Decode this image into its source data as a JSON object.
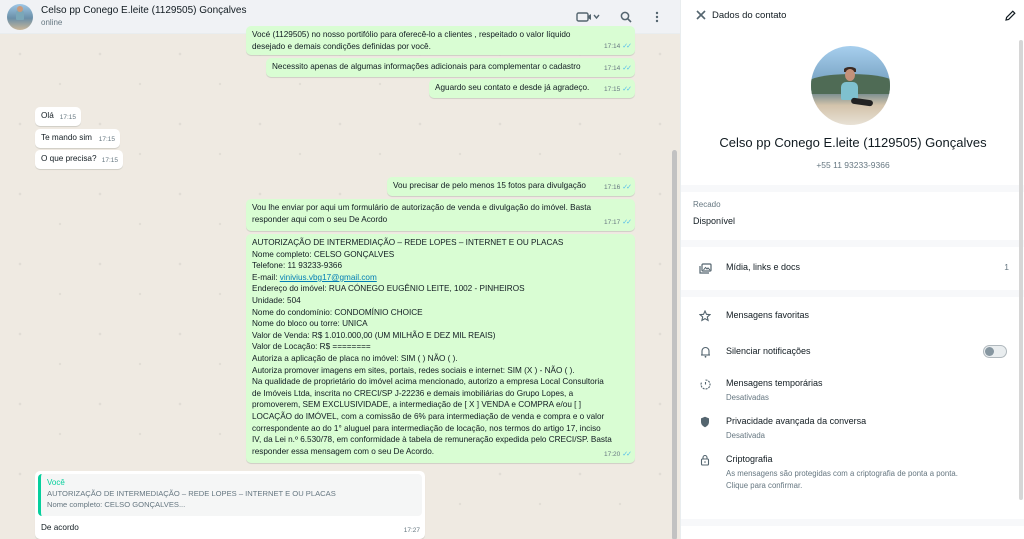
{
  "chat": {
    "title": "Celso pp Conego E.leite (1129505) Gonçalves",
    "status": "online",
    "icons": {
      "video": "video-call-icon",
      "search": "search-icon",
      "menu": "menu-icon"
    }
  },
  "messages": [
    {
      "dir": "out",
      "lines": [
        "Vocé (1129505) no nosso portifólio para oferecê-lo a clientes , respeitado o valor líquido",
        "desejado e demais condições definidas por você."
      ],
      "time": "17:14",
      "read": true
    },
    {
      "dir": "out",
      "lines": [
        "Necessito apenas de algumas informações adicionais para complementar o cadastro"
      ],
      "time": "17:14",
      "read": true
    },
    {
      "dir": "out",
      "lines": [
        "Aguardo seu contato e desde já agradeço."
      ],
      "time": "17:15",
      "read": true
    },
    {
      "dir": "in",
      "lines": [
        "Olá"
      ],
      "time": "17:15"
    },
    {
      "dir": "in",
      "lines": [
        "Te mando sim"
      ],
      "time": "17:15"
    },
    {
      "dir": "in",
      "lines": [
        "O que precisa?"
      ],
      "time": "17:15"
    },
    {
      "dir": "out",
      "lines": [
        "Vou precisar de pelo menos 15 fotos para divulgação"
      ],
      "time": "17:16",
      "read": true
    },
    {
      "dir": "out",
      "lines": [
        "Vou lhe enviar por aqui um formulário de autorização de venda e divulgação do imóvel. Basta",
        "responder aqui com o seu De Acordo"
      ],
      "time": "17:17",
      "read": true
    },
    {
      "dir": "out",
      "lines": [
        "AUTORIZAÇÃO DE INTERMEDIAÇÃO – REDE LOPES – INTERNET E OU PLACAS",
        "Nome completo: CELSO GONÇALVES",
        "Telefone: 11 93233-9366",
        "E-mail: vinivius.vbg17@gmail.com",
        "Endereço do imóvel: RUA CÓNEGO EUGÊNIO LEITE, 1002 - PINHEIROS",
        "Unidade: 504",
        "Nome do condomínio: CONDOMÍNIO CHOICE",
        "Nome do bloco ou torre: UNICA",
        "Valor de Venda: R$ 1.010.000,00 (UM MILHÃO E DEZ MIL REAIS)",
        "Valor de Locação: R$ ========",
        "Autoriza a aplicação de placa no imóvel: SIM (     )  NÃO (     ).",
        "Autoriza promover imagens em sites, portais, redes sociais e internet: SIM (X ) - NÃO (     ).",
        "Na qualidade de proprietário do imóvel acima mencionado, autorizo a empresa Local Consultoria",
        "de Imóveis Ltda, inscrita no CRECI/SP J-22236 e demais imobiliárias do Grupo Lopes, a",
        "promoverem, SEM EXCLUSIVIDADE, a intermediação de [   X   ] VENDA e COMPRA e/ou [    ]",
        "LOCAÇÃO do IMÓVEL, com a comissão de 6% para intermediação de venda e compra e o valor",
        "correspondente ao do 1° aluguel para intermediação de locação, nos termos do artigo 17, inciso",
        "IV, da Lei n.º 6.530/78, em conformidade à tabela de remuneração expedida pelo CRECI/SP. Basta",
        "responder essa mensagem com o seu De Acordo."
      ],
      "time": "17:20",
      "read": true
    },
    {
      "dir": "in",
      "quote_author": "Você",
      "quote_lines": [
        "AUTORIZAÇÃO DE INTERMEDIAÇÃO – REDE LOPES – INTERNET E OU PLACAS",
        "Nome completo: CELSO GONÇALVES..."
      ],
      "lines": [
        "De acordo"
      ],
      "time": "17:27"
    }
  ],
  "contact": {
    "header_title": "Dados do contato",
    "name": "Celso pp Conego E.leite (1129505) Gonçalves",
    "phone": "+55 11 93233-9366",
    "about_label": "Recado",
    "about_value": "Disponível",
    "media_label": "Mídia, links e docs",
    "media_count": "1",
    "starred_label": "Mensagens favoritas",
    "mute_label": "Silenciar notificações",
    "mute_on": false,
    "disappearing_label": "Mensagens temporárias",
    "disappearing_value": "Desativadas",
    "privacy_label": "Privacidade avançada da conversa",
    "privacy_value": "Desativada",
    "encryption_label": "Criptografia",
    "encryption_line1": "As mensagens são protegidas com a criptografia de ponta a ponta.",
    "encryption_line2": "Clique para confirmar."
  },
  "colors": {
    "outgoing": "#d9fdd3",
    "incoming": "#ffffff",
    "chat_bg": "#efeae2",
    "read_check": "#53bdeb"
  }
}
